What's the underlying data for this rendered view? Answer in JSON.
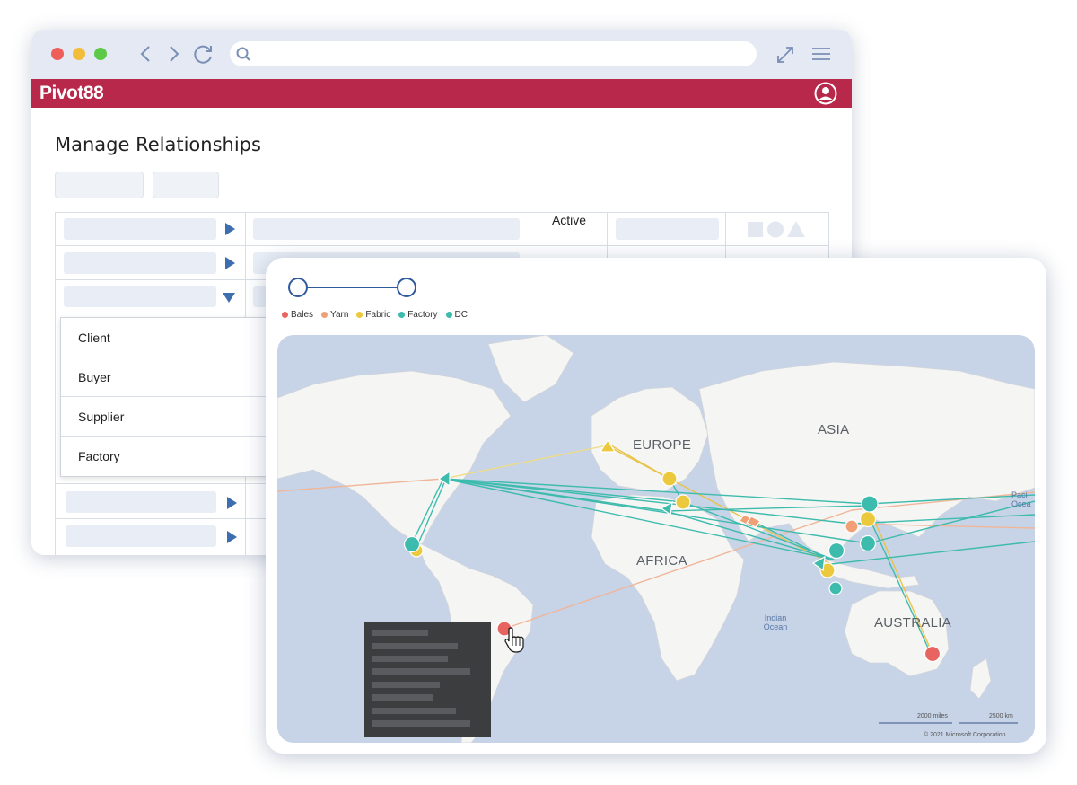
{
  "app": {
    "logo": "Pivot88"
  },
  "page": {
    "title": "Manage Relationships"
  },
  "table": {
    "status_cell": "Active"
  },
  "dropdown": {
    "options": [
      "Client",
      "Buyer",
      "Supplier",
      "Factory"
    ]
  },
  "legend": {
    "items": [
      {
        "label": "Bales",
        "color": "#e86460"
      },
      {
        "label": "Yarn",
        "color": "#f0a074"
      },
      {
        "label": "Fabric",
        "color": "#ecc93c"
      },
      {
        "label": "Factory",
        "color": "#3dbbad"
      },
      {
        "label": "DC",
        "color": "#3dbbad"
      }
    ]
  },
  "map": {
    "regions": [
      "EUROPE",
      "ASIA",
      "AFRICA",
      "AUSTRALIA"
    ],
    "oceans": [
      "Indian\nOcean",
      "Paci\nOcea"
    ],
    "scale": {
      "miles": "2000 miles",
      "km": "2500 km"
    },
    "copyright": "© 2021 Microsoft Corporation"
  }
}
